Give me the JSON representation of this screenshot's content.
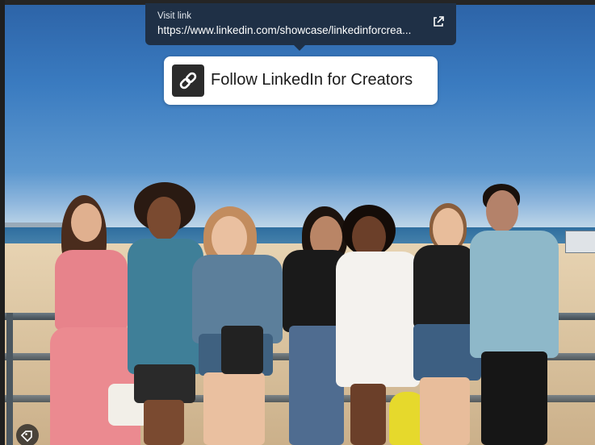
{
  "tooltip": {
    "label": "Visit link",
    "url": "https://www.linkedin.com/showcase/linkedinforcrea...",
    "icon": "external-link-icon"
  },
  "follow_button": {
    "label": "Follow LinkedIn for Creators",
    "icon": "link-icon"
  },
  "photo": {
    "tag_icon": "tag-icon"
  },
  "colors": {
    "tooltip_bg": "#1f3046",
    "follow_bg": "#ffffff",
    "icon_box": "#2b2b2b"
  }
}
